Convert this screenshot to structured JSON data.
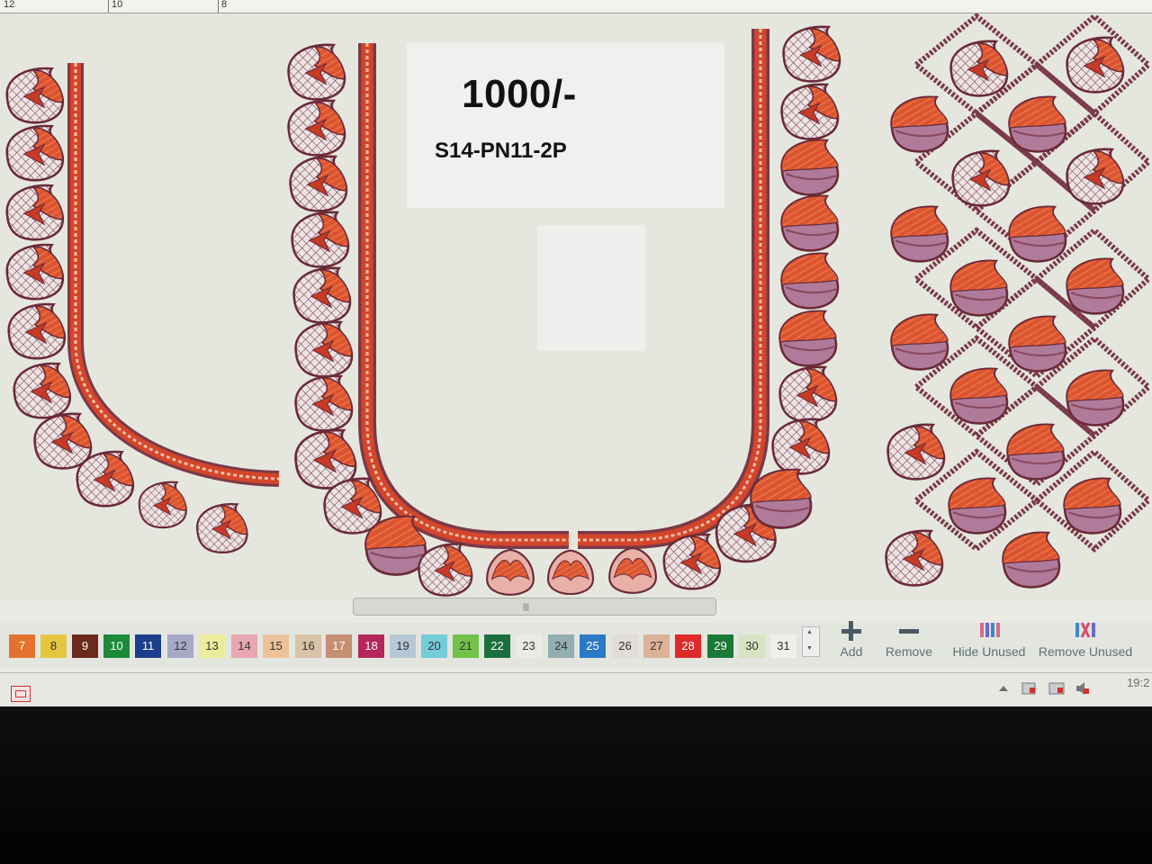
{
  "ruler": {
    "labels": [
      "12",
      "10",
      "8"
    ]
  },
  "card": {
    "price": "1000/-",
    "code": "S14-PN11-2P"
  },
  "palette": {
    "swatches": [
      {
        "n": "7",
        "color": "#e4722e",
        "text": "#ffffff"
      },
      {
        "n": "8",
        "color": "#e6c63e",
        "text": "#333333"
      },
      {
        "n": "9",
        "color": "#6b2a1c",
        "text": "#ffffff"
      },
      {
        "n": "10",
        "color": "#1d8a3a",
        "text": "#ffffff"
      },
      {
        "n": "11",
        "color": "#1b3f8c",
        "text": "#ffffff"
      },
      {
        "n": "12",
        "color": "#a6a8c6",
        "text": "#333333"
      },
      {
        "n": "13",
        "color": "#ecec9c",
        "text": "#333333"
      },
      {
        "n": "14",
        "color": "#e8a6b2",
        "text": "#333333"
      },
      {
        "n": "15",
        "color": "#edc29a",
        "text": "#333333"
      },
      {
        "n": "16",
        "color": "#d8c2a8",
        "text": "#333333"
      },
      {
        "n": "17",
        "color": "#c68e72",
        "text": "#ffffff"
      },
      {
        "n": "18",
        "color": "#b5265a",
        "text": "#ffffff"
      },
      {
        "n": "19",
        "color": "#b6c8d6",
        "text": "#333333"
      },
      {
        "n": "20",
        "color": "#73ccd8",
        "text": "#333333"
      },
      {
        "n": "21",
        "color": "#72c24a",
        "text": "#333333"
      },
      {
        "n": "22",
        "color": "#1b6e3e",
        "text": "#ffffff"
      },
      {
        "n": "23",
        "color": "#e9ebe4",
        "text": "#333333"
      },
      {
        "n": "24",
        "color": "#92aeb0",
        "text": "#333333"
      },
      {
        "n": "25",
        "color": "#2b7ac8",
        "text": "#ffffff"
      },
      {
        "n": "26",
        "color": "#e2dcd6",
        "text": "#333333"
      },
      {
        "n": "27",
        "color": "#dcb298",
        "text": "#333333"
      },
      {
        "n": "28",
        "color": "#e02a2a",
        "text": "#ffffff"
      },
      {
        "n": "29",
        "color": "#1a7a36",
        "text": "#ffffff"
      },
      {
        "n": "30",
        "color": "#d8e2c2",
        "text": "#333333"
      },
      {
        "n": "31",
        "color": "#eeeeea",
        "text": "#333333"
      }
    ]
  },
  "tools": {
    "add": "Add",
    "remove": "Remove",
    "hide_unused": "Hide Unused",
    "remove_unused": "Remove Unused"
  },
  "taskbar": {
    "clock": "19:2"
  },
  "colors": {
    "thread_red": "#d4452a",
    "thread_pink": "#b07b9a",
    "outline": "#7a3a48"
  }
}
